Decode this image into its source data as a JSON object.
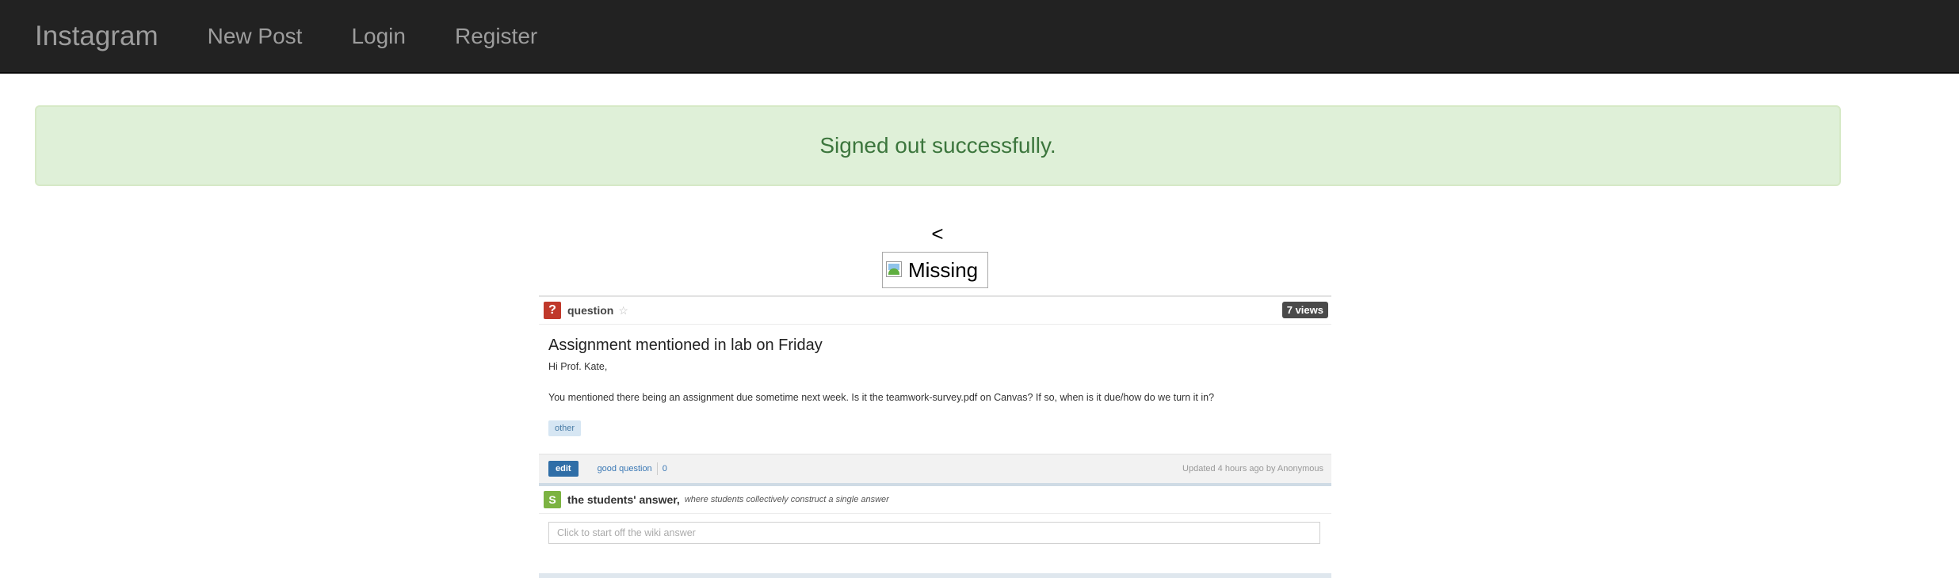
{
  "navbar": {
    "brand": "Instagram",
    "links": [
      "New Post",
      "Login",
      "Register"
    ]
  },
  "alert": {
    "message": "Signed out successfully."
  },
  "post": {
    "caret": "<",
    "image_alt": "Missing",
    "screenshot": {
      "question_label": "question",
      "views": "7 views",
      "title": "Assignment mentioned in lab on Friday",
      "greeting": "Hi Prof. Kate,",
      "body": "You mentioned there being an assignment due sometime next week. Is it the teamwork-survey.pdf on Canvas? If so, when is it due/how do we turn it in?",
      "tag": "other",
      "edit_label": "edit",
      "good_question_label": "good question",
      "good_question_count": "0",
      "updated": "Updated 4 hours ago by Anonymous",
      "answer_badge": "S",
      "answer_title": "the students' answer,",
      "answer_subtitle": "where students collectively construct a single answer",
      "answer_placeholder": "Click to start off the wiki answer",
      "question_badge": "?",
      "star_icon": "star-icon"
    }
  },
  "colors": {
    "navbar_bg": "#222222",
    "alert_bg": "#dff0d8",
    "alert_text": "#3c763d"
  }
}
